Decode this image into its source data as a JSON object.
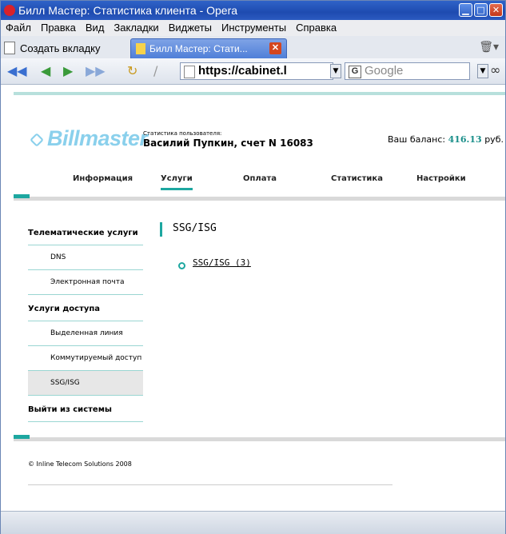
{
  "window": {
    "title": "Билл Мастер: Статистика клиента - Opera"
  },
  "menu": [
    "Файл",
    "Правка",
    "Вид",
    "Закладки",
    "Виджеты",
    "Инструменты",
    "Справка"
  ],
  "tabs": {
    "new_tab_label": "Создать вкладку",
    "active_tab_label": "Билл Мастер: Стати..."
  },
  "address": {
    "value": "https://cabinet.l"
  },
  "search": {
    "placeholder": "Google"
  },
  "page": {
    "brand": "Billmaster",
    "user_stats_label": "Статистика пользователя:",
    "user_name": "Василий Пупкин, счет N 16083",
    "balance_label": "Ваш баланс:",
    "balance_value": "416.13",
    "balance_currency": "руб.",
    "nav": [
      "Информация",
      "Услуги",
      "Оплата",
      "Статистика",
      "Настройки"
    ],
    "nav_active": "Услуги",
    "sidebar": [
      {
        "label": "Телематические услуги",
        "type": "head"
      },
      {
        "label": "DNS",
        "type": "sub"
      },
      {
        "label": "Электронная почта",
        "type": "sub"
      },
      {
        "label": "Услуги доступа",
        "type": "head"
      },
      {
        "label": "Выделенная линия",
        "type": "sub"
      },
      {
        "label": "Коммутируемый доступ",
        "type": "sub"
      },
      {
        "label": "SSG/ISG",
        "type": "sub",
        "selected": true
      },
      {
        "label": "Выйти из системы",
        "type": "head"
      }
    ],
    "content_title": "SSG/ISG",
    "content_link": "SSG/ISG (3)",
    "copyright": "© Inline Telecom Solutions 2008"
  },
  "colors": {
    "accent": "#1da7a0",
    "titlebar": "#2f63c8",
    "brand": "#8ad0ec"
  }
}
